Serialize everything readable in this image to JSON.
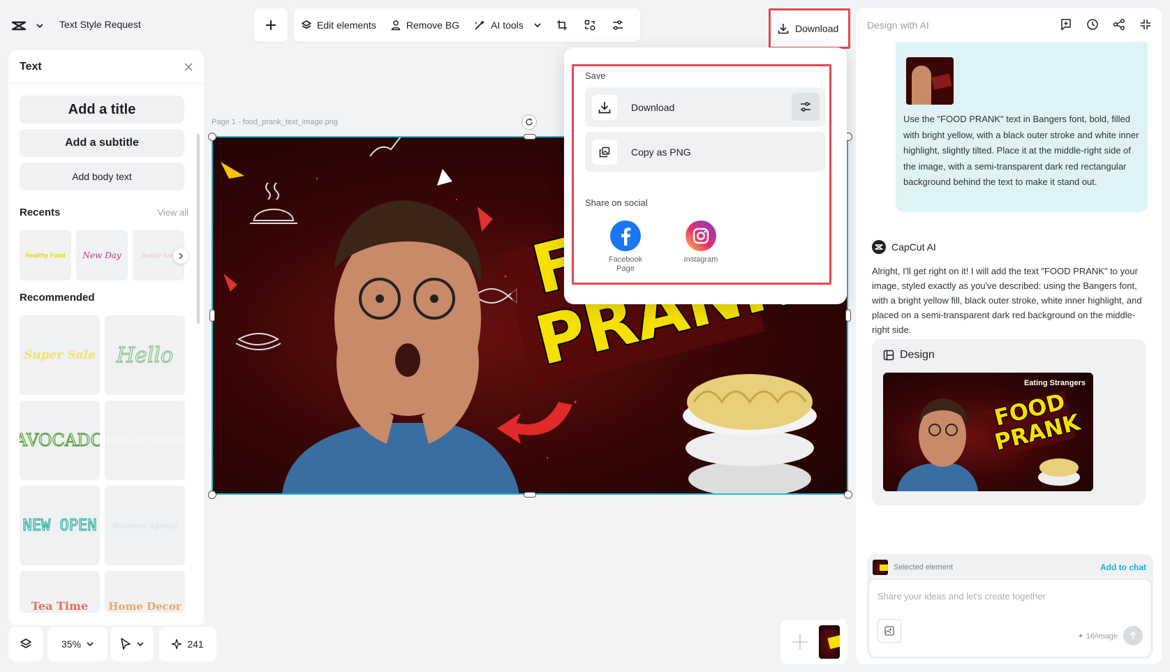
{
  "header": {
    "doc_title": "Text Style Request",
    "tools": {
      "edit_elements": "Edit elements",
      "remove_bg": "Remove BG",
      "ai_tools": "AI tools"
    },
    "download_label": "Download"
  },
  "left_panel": {
    "title": "Text",
    "add_title": "Add a title",
    "add_subtitle": "Add a subtitle",
    "add_body": "Add body text",
    "recents_title": "Recents",
    "view_all": "View all",
    "recents": [
      "Healthy Food",
      "New Day",
      "Beauty Sale"
    ],
    "recommended_title": "Recommended",
    "recommended": [
      "Super Sale",
      "Hello",
      "AVOCADO",
      "Organic Product",
      "NEW OPEN",
      "Business Agency",
      "Tea Time",
      "Home Decor"
    ]
  },
  "bottom_controls": {
    "zoom": "35%",
    "credits": "241"
  },
  "canvas": {
    "page_label": "Page 1 -  food_prank_text_image.png",
    "headline_top": "FOOD",
    "headline_bottom": "PRANK"
  },
  "download_menu": {
    "save_heading": "Save",
    "download": "Download",
    "copy_png": "Copy as PNG",
    "share_heading": "Share on social",
    "facebook": "Facebook Page",
    "instagram": "Instagram"
  },
  "ai_panel": {
    "title": "Design with AI",
    "user_message": "Use the \"FOOD PRANK\" text in Bangers font, bold, filled with bright yellow, with a black outer stroke and white inner highlight, slightly tilted. Place it at the middle-right side of the image, with a semi-transparent dark red rectangular background behind the text to make it stand out.",
    "ai_name": "CapCut AI",
    "ai_message": "Alright, I'll get right on it! I will add the text \"FOOD PRANK\" to your image, styled exactly as you've described: using the Bangers font, with a bright yellow fill, black outer stroke, white inner highlight, and placed on a semi-transparent dark red background on the middle-right side.",
    "design_label": "Design",
    "design_caption": "Eating Strangers",
    "design_headline_top": "FOOD",
    "design_headline_bottom": "PRANK",
    "selected_element": "Selected element",
    "add_to_chat": "Add to chat",
    "placeholder": "Share your ideas and let's create together",
    "cost": "✦ 16/image"
  },
  "colors": {
    "accent": "#16b4d1",
    "highlight_frame": "#e5484d",
    "bubble": "#dff3f7",
    "headline_fill": "#f6e000"
  }
}
